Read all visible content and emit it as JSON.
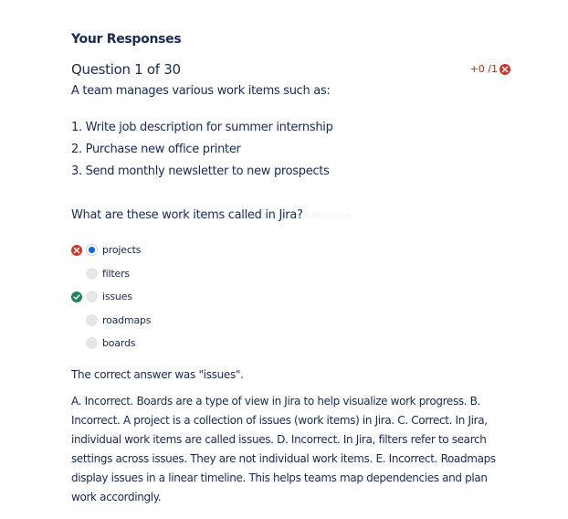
{
  "header": {
    "title": "Your Responses"
  },
  "question": {
    "title": "Question 1 of 30",
    "score": "+0 /1",
    "intro": "A team manages various work items such as:",
    "items": [
      "1. Write job description for summer internship",
      "2. Purchase new office printer",
      "3. Send monthly newsletter to new prospects"
    ],
    "prompt": "What are these work items called in Jira?",
    "hint": "Select one",
    "options": [
      {
        "label": "projects",
        "selected": true,
        "result": "incorrect"
      },
      {
        "label": "filters",
        "selected": false,
        "result": ""
      },
      {
        "label": "issues",
        "selected": false,
        "result": "correct"
      },
      {
        "label": "roadmaps",
        "selected": false,
        "result": ""
      },
      {
        "label": "boards",
        "selected": false,
        "result": ""
      }
    ]
  },
  "feedback": {
    "correct_answer": "The correct answer was \"issues\".",
    "explanation": "A. Incorrect. Boards are a type of view in Jira to help visualize work progress. B. Incorrect. A project is a collection of issues (work items) in Jira. C. Correct. In Jira, individual work items are called issues. D. Incorrect. In Jira, filters refer to search settings across issues. They are not individual work items. E. Incorrect. Roadmaps display issues in a linear timeline. This helps teams map dependencies and plan work accordingly."
  },
  "colors": {
    "incorrect": "#c9372c",
    "correct": "#1f845a",
    "selected": "#0c66e4",
    "text": "#172b4d"
  },
  "icons": {
    "incorrect": "x-circle-icon",
    "correct": "check-circle-icon"
  }
}
